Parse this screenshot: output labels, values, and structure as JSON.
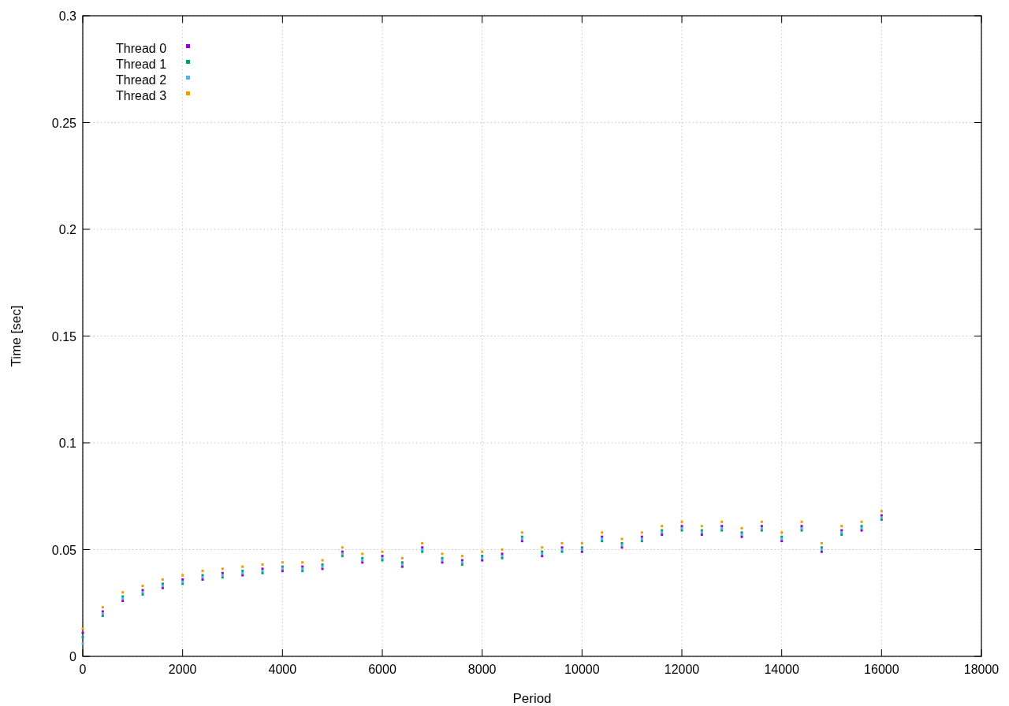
{
  "chart_data": {
    "type": "scatter",
    "grid": true,
    "legend": true,
    "xlabel": "Period",
    "ylabel": "Time [sec]",
    "xlim": [
      0,
      18000
    ],
    "ylim": [
      0,
      0.3
    ],
    "xticks": [
      0,
      2000,
      4000,
      6000,
      8000,
      10000,
      12000,
      14000,
      16000,
      18000
    ],
    "yticks": [
      {
        "value": 0,
        "label": "0"
      },
      {
        "value": 0.05,
        "label": "0.05"
      },
      {
        "value": 0.1,
        "label": "0.1"
      },
      {
        "value": 0.15,
        "label": "0.15"
      },
      {
        "value": 0.2,
        "label": "0.2"
      },
      {
        "value": 0.25,
        "label": "0.25"
      },
      {
        "value": 0.3,
        "label": "0.3"
      }
    ],
    "x": [
      0,
      400,
      800,
      1200,
      1600,
      2000,
      2400,
      2800,
      3200,
      3600,
      4000,
      4400,
      4800,
      5200,
      5600,
      6000,
      6400,
      6800,
      7200,
      7600,
      8000,
      8400,
      8800,
      9200,
      9600,
      10000,
      10400,
      10800,
      11200,
      11600,
      12000,
      12400,
      12800,
      13200,
      13600,
      14000,
      14400,
      14800,
      15200,
      15600,
      16000
    ],
    "series": [
      {
        "name": "Thread 0",
        "color": "#9400d3",
        "values": [
          0.011,
          0.021,
          0.026,
          0.031,
          0.032,
          0.036,
          0.036,
          0.039,
          0.038,
          0.041,
          0.04,
          0.042,
          0.041,
          0.049,
          0.044,
          0.047,
          0.042,
          0.051,
          0.044,
          0.045,
          0.045,
          0.048,
          0.054,
          0.047,
          0.051,
          0.049,
          0.056,
          0.051,
          0.056,
          0.057,
          0.061,
          0.057,
          0.061,
          0.056,
          0.061,
          0.054,
          0.061,
          0.049,
          0.059,
          0.059,
          0.066
        ]
      },
      {
        "name": "Thread 1",
        "color": "#009e73",
        "values": [
          0.009,
          0.019,
          0.028,
          0.029,
          0.034,
          0.034,
          0.038,
          0.037,
          0.04,
          0.039,
          0.042,
          0.04,
          0.043,
          0.047,
          0.046,
          0.045,
          0.044,
          0.049,
          0.046,
          0.043,
          0.047,
          0.046,
          0.056,
          0.049,
          0.049,
          0.051,
          0.054,
          0.053,
          0.054,
          0.059,
          0.059,
          0.059,
          0.059,
          0.058,
          0.059,
          0.056,
          0.059,
          0.051,
          0.057,
          0.061,
          0.064
        ]
      },
      {
        "name": "Thread 2",
        "color": "#56b4e9",
        "values": [
          0.006,
          0.02,
          0.027,
          0.03,
          0.033,
          0.035,
          0.037,
          0.038,
          0.039,
          0.04,
          0.041,
          0.041,
          0.042,
          0.048,
          0.045,
          0.046,
          0.043,
          0.05,
          0.045,
          0.044,
          0.046,
          0.047,
          0.055,
          0.048,
          0.05,
          0.05,
          0.055,
          0.052,
          0.055,
          0.058,
          0.06,
          0.058,
          0.06,
          0.057,
          0.06,
          0.055,
          0.06,
          0.05,
          0.058,
          0.06,
          0.065
        ]
      },
      {
        "name": "Thread 3",
        "color": "#e69f00",
        "values": [
          0.013,
          0.023,
          0.03,
          0.033,
          0.036,
          0.038,
          0.04,
          0.041,
          0.042,
          0.043,
          0.044,
          0.044,
          0.045,
          0.051,
          0.048,
          0.049,
          0.046,
          0.053,
          0.048,
          0.047,
          0.049,
          0.05,
          0.058,
          0.051,
          0.053,
          0.053,
          0.058,
          0.055,
          0.058,
          0.061,
          0.063,
          0.061,
          0.063,
          0.06,
          0.063,
          0.058,
          0.063,
          0.053,
          0.061,
          0.063,
          0.068
        ]
      }
    ]
  }
}
